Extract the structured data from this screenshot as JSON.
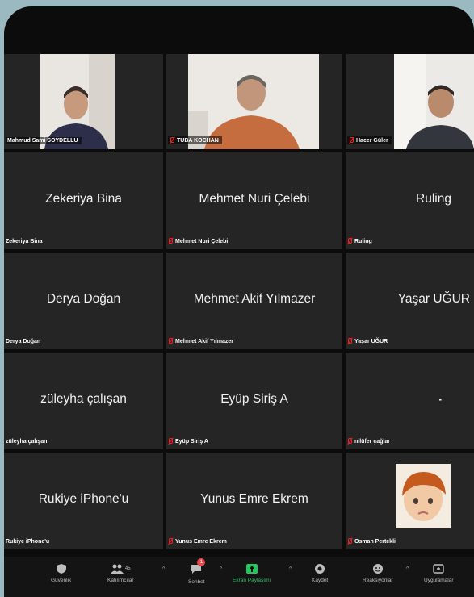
{
  "meeting": {
    "tiles": [
      {
        "big": "",
        "label": "Mahmud Sami SOYDELLU",
        "muted": false,
        "video": "person"
      },
      {
        "big": "",
        "label": "TUBA KOCHAN",
        "muted": true,
        "video": "person"
      },
      {
        "big": "",
        "label": "Hacer Güler",
        "muted": true,
        "video": "person"
      },
      {
        "big": "Zekeriya Bina",
        "label": "Zekeriya Bina",
        "muted": false
      },
      {
        "big": "Mehmet Nuri Çelebi",
        "label": "Mehmet Nuri Çelebi",
        "muted": true
      },
      {
        "big": "Ruling",
        "label": "Ruling",
        "muted": true
      },
      {
        "big": "Derya Doğan",
        "label": "Derya Doğan",
        "muted": false
      },
      {
        "big": "Mehmet Akif Yılmazer",
        "label": "Mehmet Akif Yılmazer",
        "muted": true
      },
      {
        "big": "Yaşar UĞUR",
        "label": "Yaşar UĞUR",
        "muted": true
      },
      {
        "big": "züleyha çalışan",
        "label": "züleyha çalışan",
        "muted": false
      },
      {
        "big": "Eyüp Siriş A",
        "label": "Eyüp Siriş A",
        "muted": true
      },
      {
        "big": "▪",
        "label": "nilüfer çağlar",
        "muted": true
      },
      {
        "big": "Rukiye iPhone'u",
        "label": "Rukiye iPhone'u",
        "muted": false
      },
      {
        "big": "Yunus Emre Ekrem",
        "label": "Yunus Emre Ekrem",
        "muted": true
      },
      {
        "big": "",
        "label": "Osman Pertekli",
        "muted": true,
        "video": "avatar"
      }
    ]
  },
  "toolbar": {
    "security": "Güvenlik",
    "participants": "Katılımcılar",
    "participants_count": "45",
    "chat": "Sohbet",
    "chat_badge": "1",
    "share": "Ekran Paylaşımı",
    "record": "Kaydet",
    "reactions": "Reaksiyonlar",
    "apps": "Uygulamalar",
    "colors": {
      "share_green": "#22c55e",
      "badge_red": "#e5484d"
    }
  }
}
